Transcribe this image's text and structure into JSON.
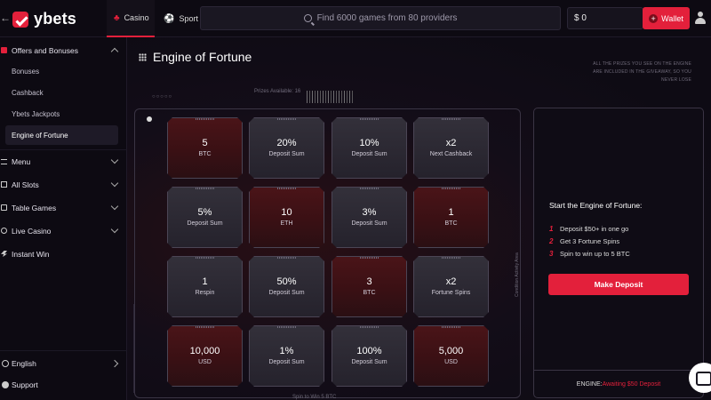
{
  "header": {
    "logo_text": "ybets",
    "tabs": [
      {
        "label": "Casino",
        "icon": "casino-icon",
        "active": true
      },
      {
        "label": "Sport",
        "icon": "soccer-ball-icon",
        "active": false
      }
    ],
    "search_placeholder": "Find 6000 games from 80 providers",
    "balance": "$ 0",
    "wallet_label": "Wallet",
    "brand_color": "#e3203b"
  },
  "sidebar": {
    "offers_label": "Offers and Bonuses",
    "sub_items": [
      {
        "label": "Bonuses",
        "active": false
      },
      {
        "label": "Cashback",
        "active": false
      },
      {
        "label": "Ybets Jackpots",
        "active": false
      },
      {
        "label": "Engine of Fortune",
        "active": true
      }
    ],
    "groups": [
      {
        "label": "Menu"
      },
      {
        "label": "All Slots"
      },
      {
        "label": "Table Games"
      },
      {
        "label": "Live Casino"
      },
      {
        "label": "Instant Win"
      }
    ],
    "language": "English",
    "support": "Support"
  },
  "main": {
    "title": "Engine of Fortune",
    "disclaimer": "ALL THE PRIZES YOU SEE ON THE ENGINE ARE INCLUDED IN THE GIVEAWAY, SO YOU NEVER LOSE",
    "prizes_label": "Prizes Available: 16",
    "side_label": "Condition Activity Area",
    "bottom_label": "Spin to Win 5 BTC",
    "tiles": [
      {
        "value": "5",
        "label": "BTC",
        "style": "red"
      },
      {
        "value": "20%",
        "label": "Deposit Sum",
        "style": "gray"
      },
      {
        "value": "10%",
        "label": "Deposit Sum",
        "style": "gray"
      },
      {
        "value": "x2",
        "label": "Next Cashback",
        "style": "gray"
      },
      {
        "value": "5%",
        "label": "Deposit Sum",
        "style": "gray"
      },
      {
        "value": "10",
        "label": "ETH",
        "style": "red"
      },
      {
        "value": "3%",
        "label": "Deposit Sum",
        "style": "gray"
      },
      {
        "value": "1",
        "label": "BTC",
        "style": "red"
      },
      {
        "value": "1",
        "label": "Respin",
        "style": "gray"
      },
      {
        "value": "50%",
        "label": "Deposit Sum",
        "style": "gray"
      },
      {
        "value": "3",
        "label": "BTC",
        "style": "red"
      },
      {
        "value": "x2",
        "label": "Fortune Spins",
        "style": "gray"
      },
      {
        "value": "10,000",
        "label": "USD",
        "style": "red"
      },
      {
        "value": "1%",
        "label": "Deposit Sum",
        "style": "gray"
      },
      {
        "value": "100%",
        "label": "Deposit Sum",
        "style": "gray"
      },
      {
        "value": "5,000",
        "label": "USD",
        "style": "red"
      }
    ]
  },
  "panel": {
    "title": "Start the Engine of Fortune:",
    "steps": [
      {
        "num": "1",
        "text": "Deposit $50+ in one go"
      },
      {
        "num": "2",
        "text": "Get 3 Fortune Spins"
      },
      {
        "num": "3",
        "text": "Spin to win up to 5 BTC"
      }
    ],
    "button_label": "Make Deposit",
    "engine_label": "ENGINE:",
    "engine_status": "Awaiting $50 Deposit"
  }
}
